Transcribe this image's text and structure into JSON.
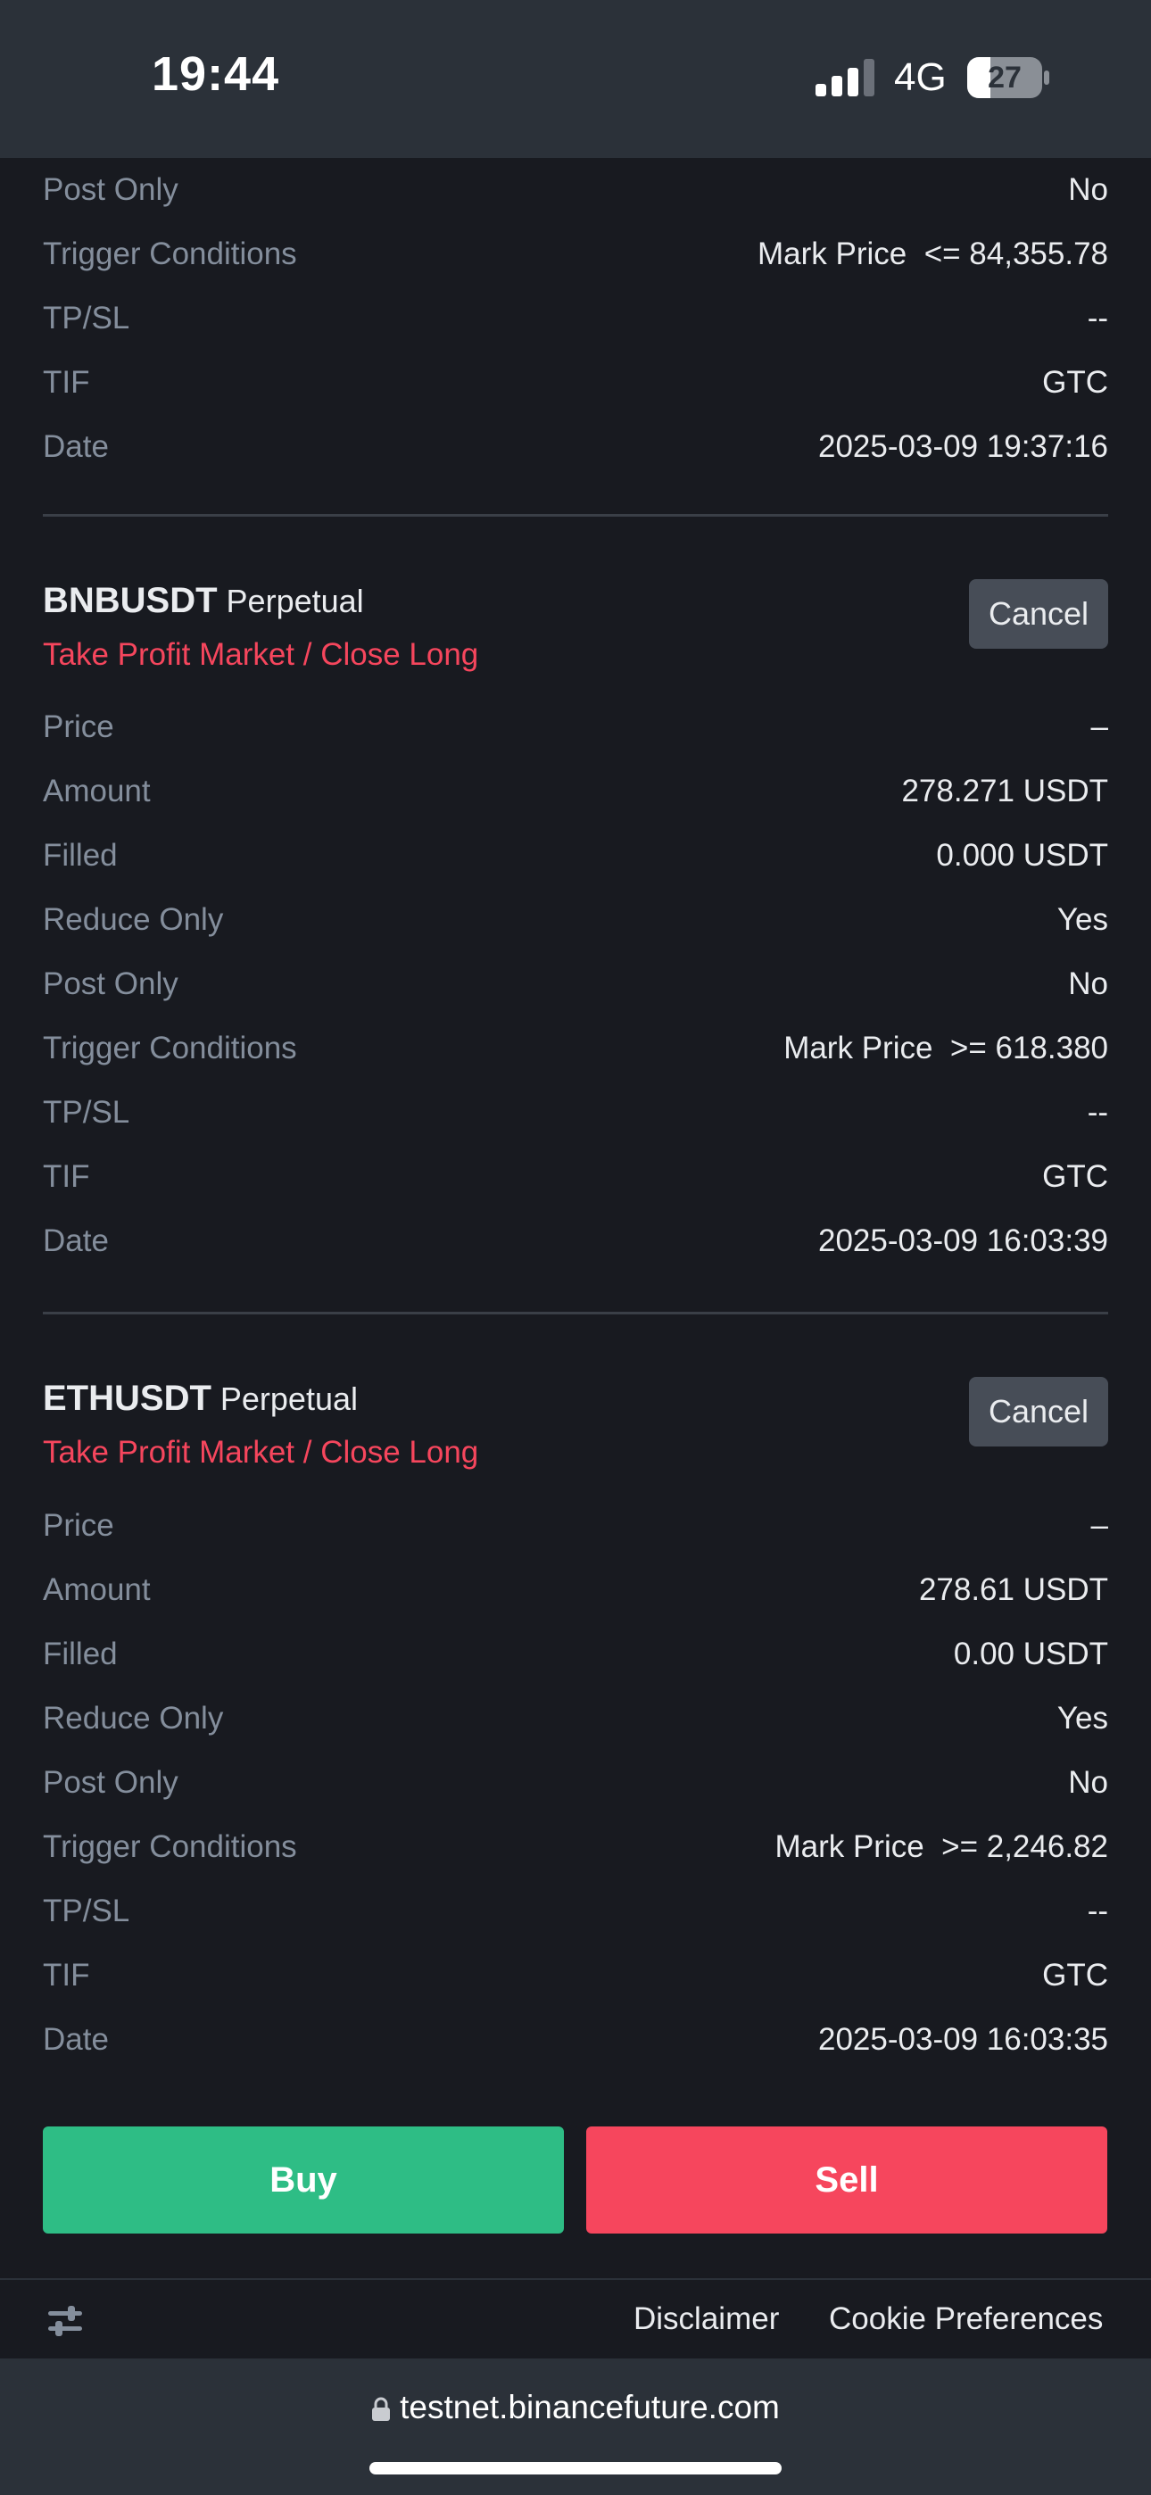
{
  "status_bar": {
    "time": "19:44",
    "network": "4G",
    "battery": "27"
  },
  "top_partial_order": {
    "rows": [
      {
        "label": "Post Only",
        "value": "No"
      },
      {
        "label": "Trigger Conditions",
        "value": "Mark Price  <= 84,355.78"
      },
      {
        "label": "TP/SL",
        "value": "--"
      },
      {
        "label": "TIF",
        "value": "GTC"
      },
      {
        "label": "Date",
        "value": "2025-03-09 19:37:16"
      }
    ]
  },
  "orders": [
    {
      "symbol": "BNBUSDT",
      "contract": "Perpetual",
      "type": "Take Profit Market / Close Long",
      "cancel_label": "Cancel",
      "rows": [
        {
          "label": "Price",
          "value": "–"
        },
        {
          "label": "Amount",
          "value": "278.271 USDT"
        },
        {
          "label": "Filled",
          "value": "0.000 USDT"
        },
        {
          "label": "Reduce Only",
          "value": "Yes"
        },
        {
          "label": "Post Only",
          "value": "No"
        },
        {
          "label": "Trigger Conditions",
          "value": "Mark Price  >= 618.380"
        },
        {
          "label": "TP/SL",
          "value": "--"
        },
        {
          "label": "TIF",
          "value": "GTC"
        },
        {
          "label": "Date",
          "value": "2025-03-09 16:03:39"
        }
      ]
    },
    {
      "symbol": "ETHUSDT",
      "contract": "Perpetual",
      "type": "Take Profit Market / Close Long",
      "cancel_label": "Cancel",
      "rows": [
        {
          "label": "Price",
          "value": "–"
        },
        {
          "label": "Amount",
          "value": "278.61 USDT"
        },
        {
          "label": "Filled",
          "value": "0.00 USDT"
        },
        {
          "label": "Reduce Only",
          "value": "Yes"
        },
        {
          "label": "Post Only",
          "value": "No"
        },
        {
          "label": "Trigger Conditions",
          "value": "Mark Price  >= 2,246.82"
        },
        {
          "label": "TP/SL",
          "value": "--"
        },
        {
          "label": "TIF",
          "value": "GTC"
        },
        {
          "label": "Date",
          "value": "2025-03-09 16:03:35"
        }
      ]
    }
  ],
  "actions": {
    "buy_label": "Buy",
    "sell_label": "Sell"
  },
  "footer": {
    "settings_icon": "sliders-icon",
    "disclaimer": "Disclaimer",
    "cookie_preferences": "Cookie Preferences"
  },
  "browser": {
    "url": "testnet.binancefuture.com"
  },
  "colors": {
    "background": "#181A20",
    "bar": "#2B3139",
    "buy": "#2EBD85",
    "sell": "#F6465D",
    "label": "#848E9C",
    "text": "#EAECEF"
  }
}
